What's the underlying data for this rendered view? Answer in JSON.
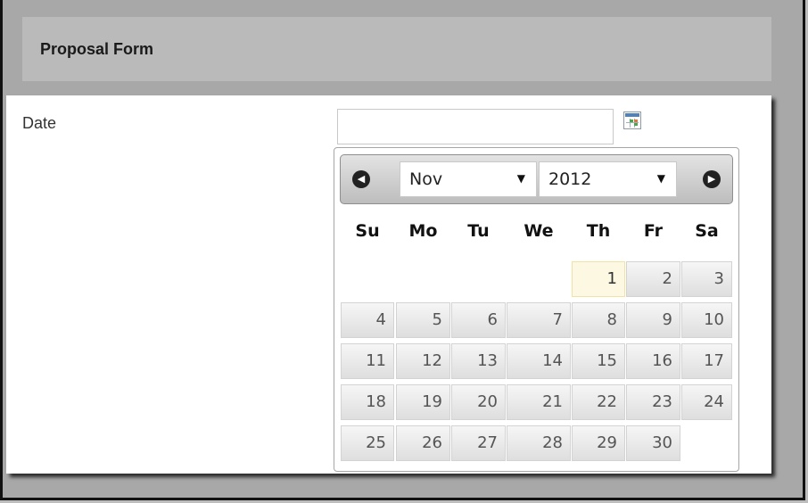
{
  "form": {
    "title": "Proposal Form",
    "date_label": "Date",
    "date_value": ""
  },
  "datepicker": {
    "month": "Nov",
    "year": "2012",
    "weekdays": [
      "Su",
      "Mo",
      "Tu",
      "We",
      "Th",
      "Fr",
      "Sa"
    ],
    "first_weekday_index": 4,
    "days": [
      "1",
      "2",
      "3",
      "4",
      "5",
      "6",
      "7",
      "8",
      "9",
      "10",
      "11",
      "12",
      "13",
      "14",
      "15",
      "16",
      "17",
      "18",
      "19",
      "20",
      "21",
      "22",
      "23",
      "24",
      "25",
      "26",
      "27",
      "28",
      "29",
      "30"
    ],
    "highlighted_day": "1",
    "prev_icon": "chevron-left-icon",
    "next_icon": "chevron-right-icon",
    "colors": {
      "highlight_bg": "#fdf8e1",
      "header_gray": "#bababa",
      "icon_blue": "#4f81bd",
      "icon_green": "#49a74b"
    }
  }
}
